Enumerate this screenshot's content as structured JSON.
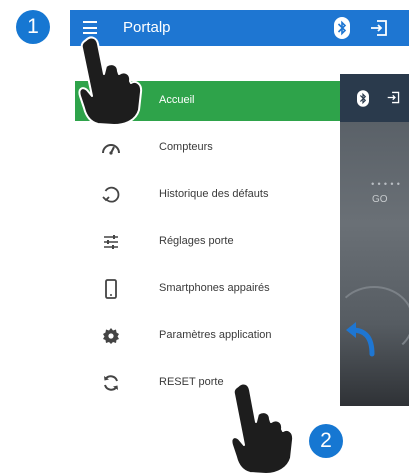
{
  "steps": {
    "first": "1",
    "second": "2"
  },
  "app_bar": {
    "title": "Portalp",
    "icons": [
      "menu-icon",
      "bluetooth-icon",
      "login-icon"
    ],
    "color": "#1e76d2"
  },
  "drawer": {
    "active_color": "#2ea34a",
    "items": [
      {
        "label": "Accueil",
        "icon": "home-icon",
        "active": true
      },
      {
        "label": "Compteurs",
        "icon": "speedometer-icon",
        "active": false
      },
      {
        "label": "Historique des défauts",
        "icon": "history-icon",
        "active": false
      },
      {
        "label": "Réglages porte",
        "icon": "sliders-icon",
        "active": false
      },
      {
        "label": "Smartphones appairés",
        "icon": "smartphone-icon",
        "active": false
      },
      {
        "label": "Paramètres application",
        "icon": "gear-icon",
        "active": false
      },
      {
        "label": "RESET porte",
        "icon": "refresh-icon",
        "active": false
      }
    ]
  },
  "background_screen": {
    "dots": "•••••",
    "status": "GO"
  }
}
